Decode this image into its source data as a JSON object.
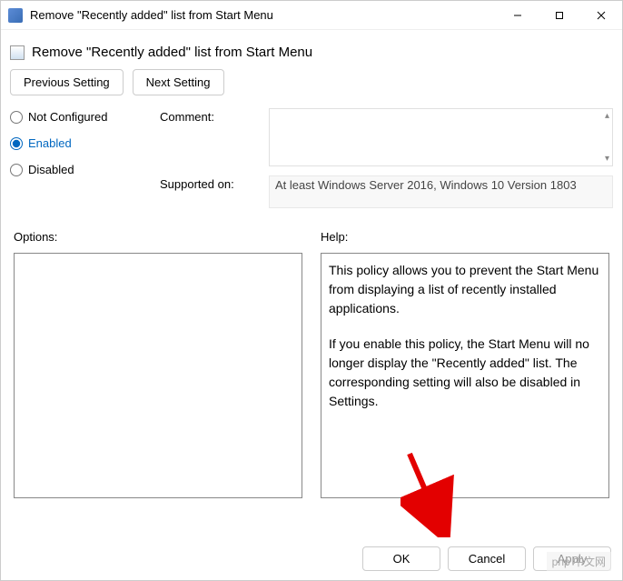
{
  "window": {
    "title": "Remove \"Recently added\" list from Start Menu"
  },
  "header": {
    "title": "Remove \"Recently added\" list from Start Menu"
  },
  "nav": {
    "previous": "Previous Setting",
    "next": "Next Setting"
  },
  "radios": {
    "not_configured": "Not Configured",
    "enabled": "Enabled",
    "disabled": "Disabled",
    "selected": "enabled"
  },
  "meta": {
    "comment_label": "Comment:",
    "comment_value": "",
    "supported_label": "Supported on:",
    "supported_value": "At least Windows Server 2016, Windows 10 Version 1803"
  },
  "panels": {
    "options_label": "Options:",
    "help_label": "Help:",
    "help_p1": "This policy allows you to prevent the Start Menu from displaying a list of recently installed applications.",
    "help_p2": "If you enable this policy, the Start Menu will no longer display the \"Recently added\" list. The corresponding setting will also be disabled in Settings."
  },
  "footer": {
    "ok": "OK",
    "cancel": "Cancel",
    "apply": "Apply"
  },
  "watermark": "php 中文网"
}
